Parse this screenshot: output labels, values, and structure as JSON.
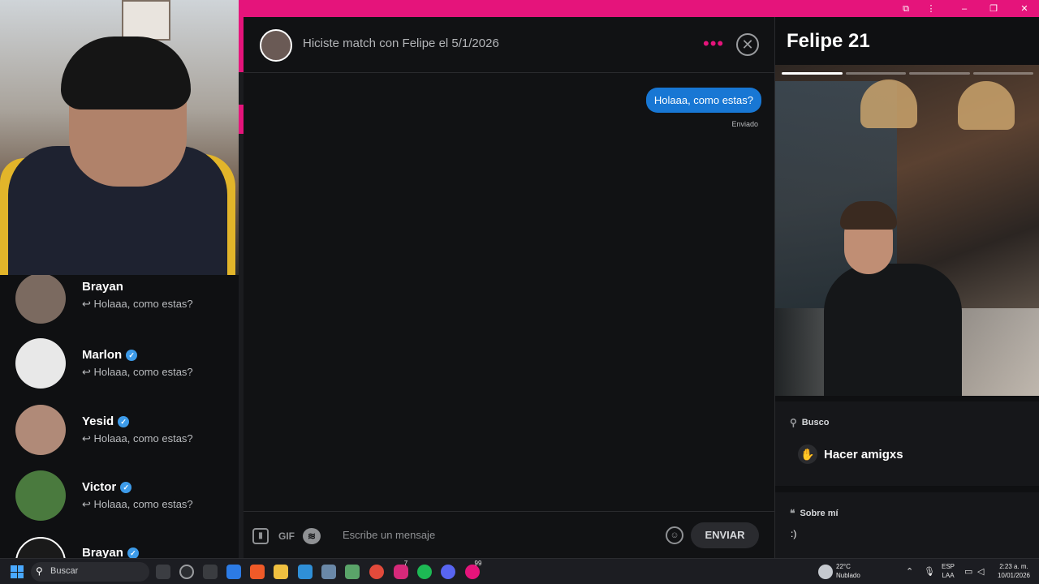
{
  "browser": {
    "extensions_icon": "puzzle-icon",
    "menu_icon": "kebab-icon",
    "minimize_icon": "minimize-icon",
    "restore_icon": "restore-icon",
    "close_icon": "close-icon"
  },
  "matches": [
    {
      "name": "Brayan",
      "verified": false,
      "last_message": "Holaaa, como estas?"
    },
    {
      "name": "Marlon",
      "verified": true,
      "last_message": "Holaaa, como estas?"
    },
    {
      "name": "Yesid",
      "verified": true,
      "last_message": "Holaaa, como estas?"
    },
    {
      "name": "Victor",
      "verified": true,
      "last_message": "Holaaa, como estas?"
    },
    {
      "name": "Brayan",
      "verified": true,
      "last_message": ""
    }
  ],
  "reply_glyph": "↩",
  "chat": {
    "header_text": "Hiciste match con Felipe el 5/1/2026",
    "dots": "•••",
    "close_glyph": "✕",
    "message": "Holaaa, como estas?",
    "status": "Enviado",
    "composer_placeholder": "Escribe un mensaje",
    "gif_label": "GIF",
    "send_label": "ENVIAR",
    "emoji_glyph": "☺"
  },
  "profile": {
    "name_age": "Felipe 21",
    "photo_count": 4,
    "photo_active_index": 0,
    "looking_label": "Busco",
    "looking_value": "Hacer amigxs",
    "about_label": "Sobre mí",
    "about_text": ":)"
  },
  "taskbar": {
    "search_placeholder": "Buscar",
    "weather_temp": "22°C",
    "weather_desc": "Nublado",
    "lang_top": "ESP",
    "lang_bottom": "LAA",
    "time": "2:23 a. m.",
    "date": "10/01/2026",
    "badge_count": "7",
    "badge_count2": "99"
  },
  "colors": {
    "accent": "#e5147b",
    "bubble": "#1877d4",
    "verified": "#3d9be9"
  }
}
